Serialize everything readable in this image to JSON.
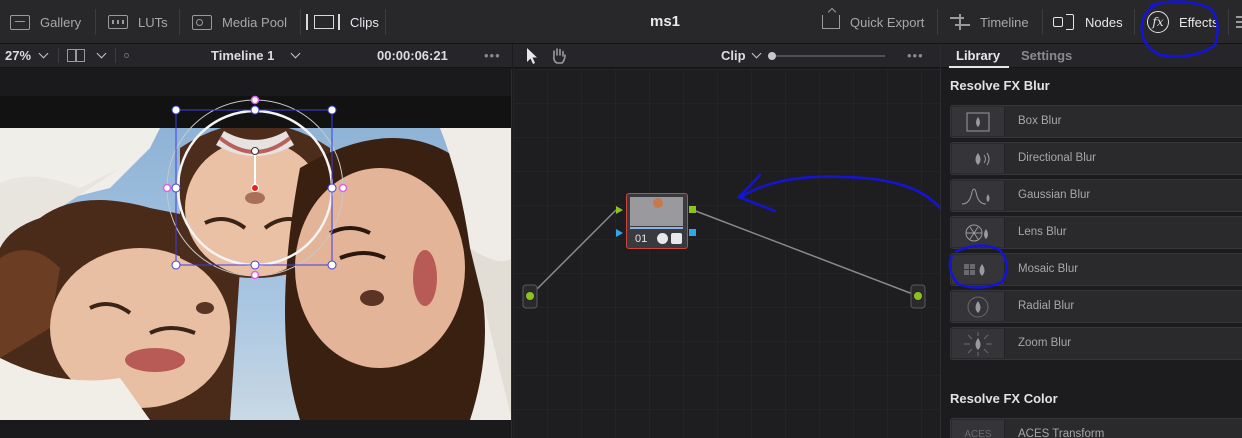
{
  "toolbar": {
    "gallery": "Gallery",
    "luts": "LUTs",
    "media_pool": "Media Pool",
    "clips": "Clips",
    "project_title": "ms1",
    "quick_export": "Quick Export",
    "timeline": "Timeline",
    "nodes": "Nodes",
    "effects": "Effects"
  },
  "viewer": {
    "zoom": "27%",
    "timeline_name": "Timeline 1",
    "timecode": "00:00:06:21",
    "more": "•••"
  },
  "node_editor": {
    "mode": "Clip",
    "more": "•••",
    "node_label": "01"
  },
  "effects_panel": {
    "tabs": [
      "Library",
      "Settings"
    ],
    "active_tab": "Library",
    "section_blur": "Resolve FX Blur",
    "blur_items": [
      "Box Blur",
      "Directional Blur",
      "Gaussian Blur",
      "Lens Blur",
      "Mosaic Blur",
      "Radial Blur",
      "Zoom Blur"
    ],
    "section_color": "Resolve FX Color",
    "color_items": [
      "ACES Transform"
    ]
  },
  "colors": {
    "annotation": "#1414d6",
    "node_border": "#d0463c",
    "input_green": "#8cc21e",
    "key_blue": "#2ea8e8",
    "handle_magenta": "#e060e0"
  },
  "icons": [
    "gallery-icon",
    "luts-icon",
    "media-pool-icon",
    "clips-icon",
    "export-icon",
    "timeline-icon",
    "nodes-icon",
    "fx-icon",
    "pointer-icon",
    "hand-icon"
  ]
}
